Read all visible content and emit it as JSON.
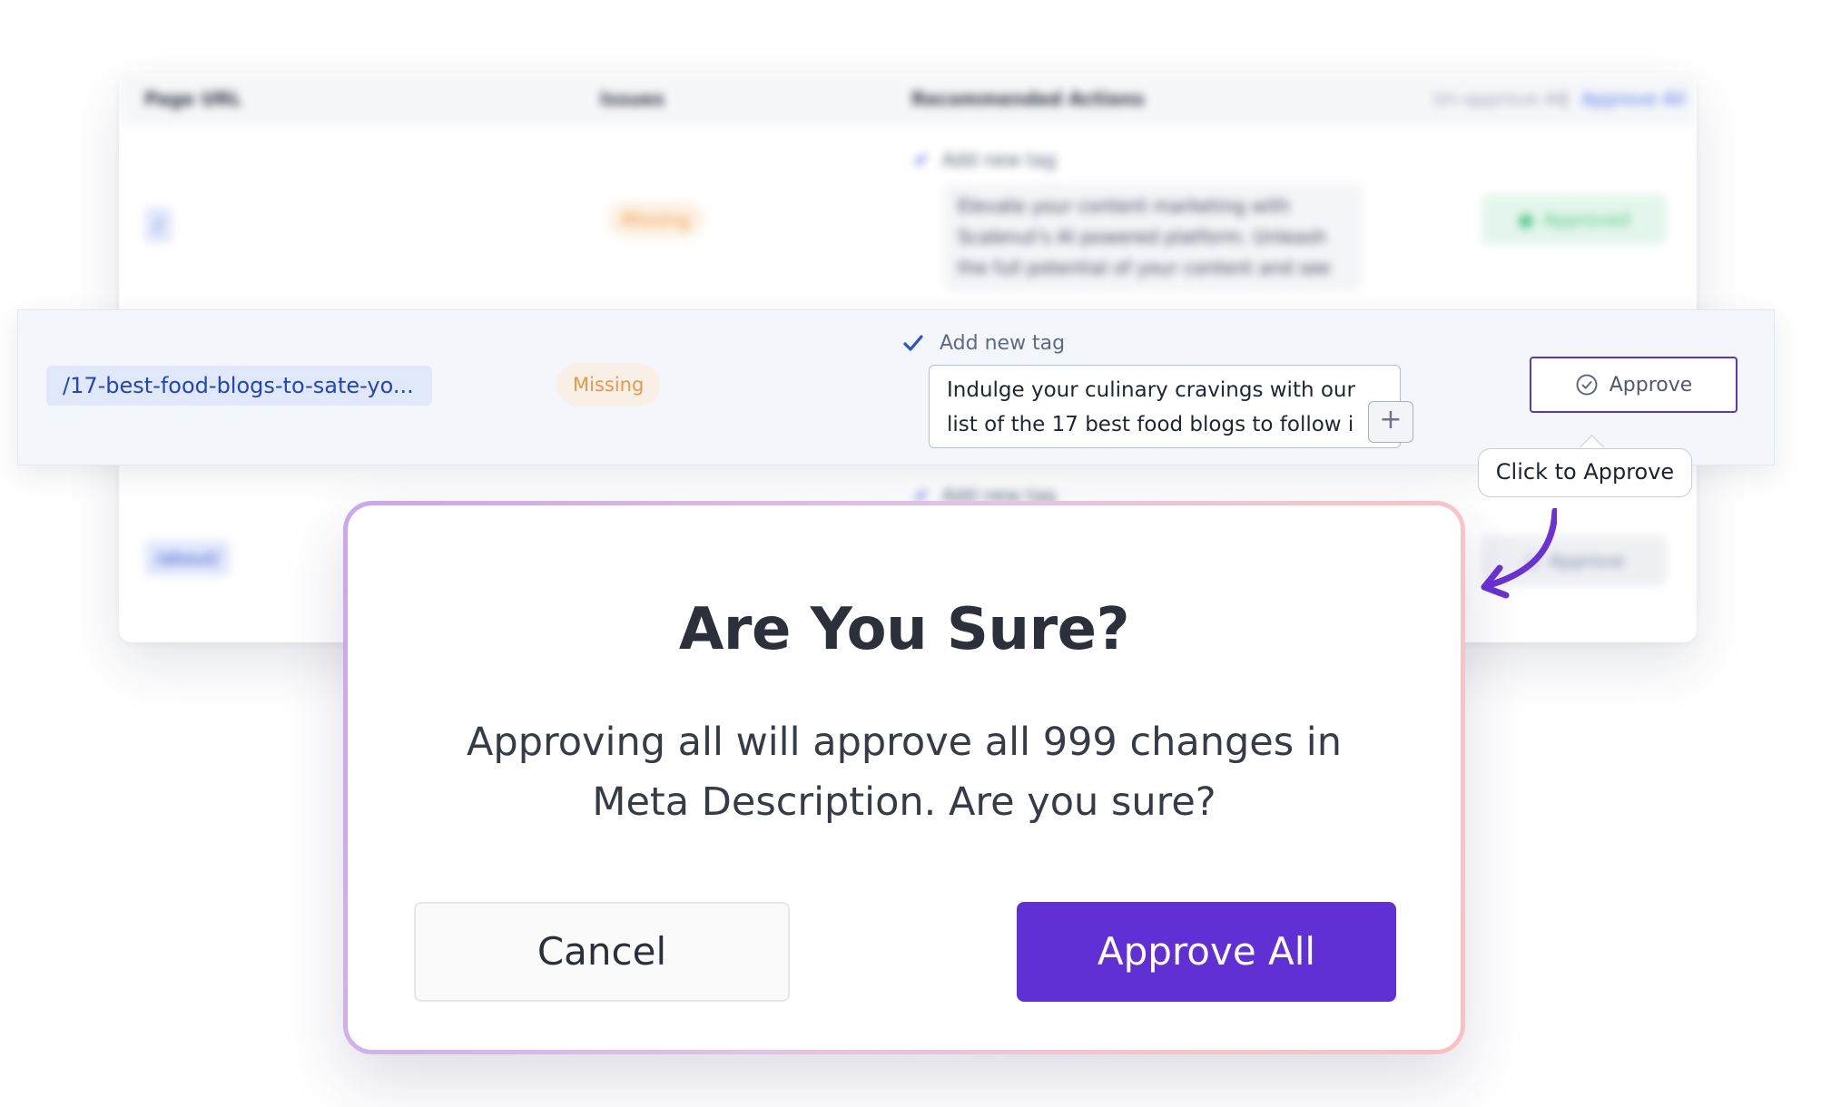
{
  "table": {
    "headers": {
      "page_url": "Page URL",
      "issues": "Issues",
      "recommended_actions": "Recommended Actions",
      "unapprove_all": "Un-approve All",
      "separator": "|",
      "approve_all": "Approve All"
    },
    "rows": [
      {
        "url": "/",
        "issue": "Missing",
        "action": "Add new tag",
        "suggestion_lines": [
          "Elevate your content marketing with",
          "Scalenut's AI powered platform. Unleash",
          "the full potential of your content and see"
        ],
        "status": "Approved"
      },
      {
        "url": "/17-best-food-blogs-to-sate-yo...",
        "issue": "Missing",
        "action": "Add new tag",
        "suggestion_lines": [
          "Indulge your culinary cravings with our",
          "list of the 17 best food blogs to follow i"
        ],
        "add_button": "+",
        "status": "Approve"
      },
      {
        "url": "/about/",
        "action": "Add new tag",
        "status": "Approve"
      }
    ]
  },
  "tooltip": {
    "text": "Click to Approve"
  },
  "modal": {
    "title": "Are You Sure?",
    "message_line1": "Approving all will approve all 999 changes in",
    "message_line2": "Meta Description. Are you sure?",
    "cancel_label": "Cancel",
    "approve_all_label": "Approve All"
  },
  "colors": {
    "accent": "#6030d4",
    "url_pill_text": "#2246b8",
    "missing_text": "#e49a47",
    "approved_text": "#53c488"
  },
  "icons": [
    "check-icon",
    "plus-icon",
    "check-circle-icon",
    "curved-arrow-icon"
  ]
}
